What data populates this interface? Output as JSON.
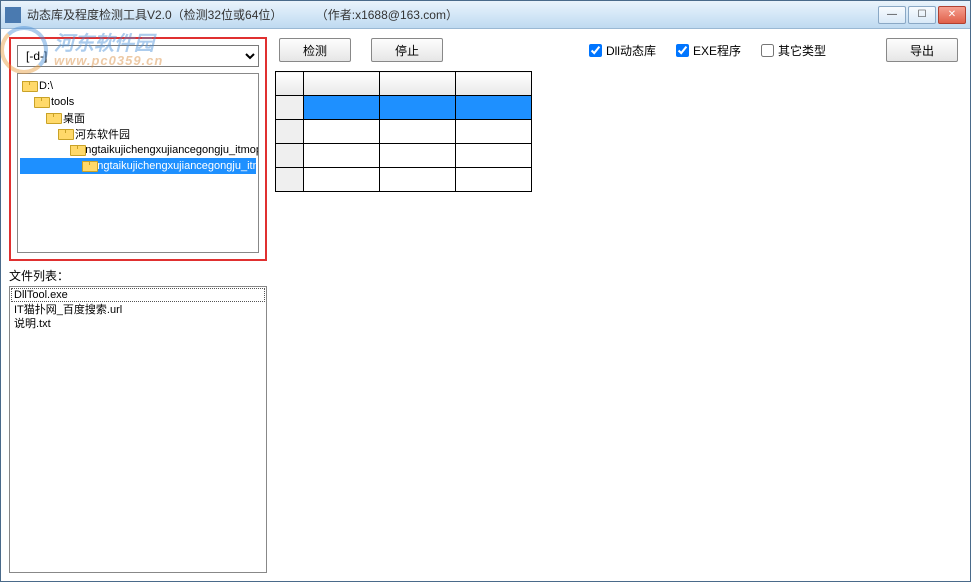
{
  "window": {
    "title": "动态库及程度检测工具V2.0（检测32位或64位）",
    "author": "（作者:x1688@163.com）"
  },
  "drive": {
    "selected": "[-d-]"
  },
  "tree": {
    "items": [
      {
        "label": "D:\\",
        "indent": 0,
        "selected": false
      },
      {
        "label": "tools",
        "indent": 1,
        "selected": false
      },
      {
        "label": "桌面",
        "indent": 2,
        "selected": false
      },
      {
        "label": "河东软件园",
        "indent": 3,
        "selected": false
      },
      {
        "label": "dongtaikujichengxujiancegongju_itmop.c",
        "indent": 4,
        "selected": false
      },
      {
        "label": "dongtaikujichengxujiancegongju_itmop.",
        "indent": 5,
        "selected": true
      }
    ]
  },
  "filelist": {
    "label": "文件列表：",
    "items": [
      {
        "name": "DllTool.exe",
        "selected": true
      },
      {
        "name": "IT猫扑网_百度搜索.url",
        "selected": false
      },
      {
        "name": "说明.txt",
        "selected": false
      }
    ]
  },
  "toolbar": {
    "detect": "检测",
    "stop": "停止",
    "export": "导出",
    "check_dll": "Dll动态库",
    "check_exe": "EXE程序",
    "check_other": "其它类型"
  },
  "watermark": {
    "cn": "河东软件园",
    "url": "www.pc0359.cn"
  }
}
